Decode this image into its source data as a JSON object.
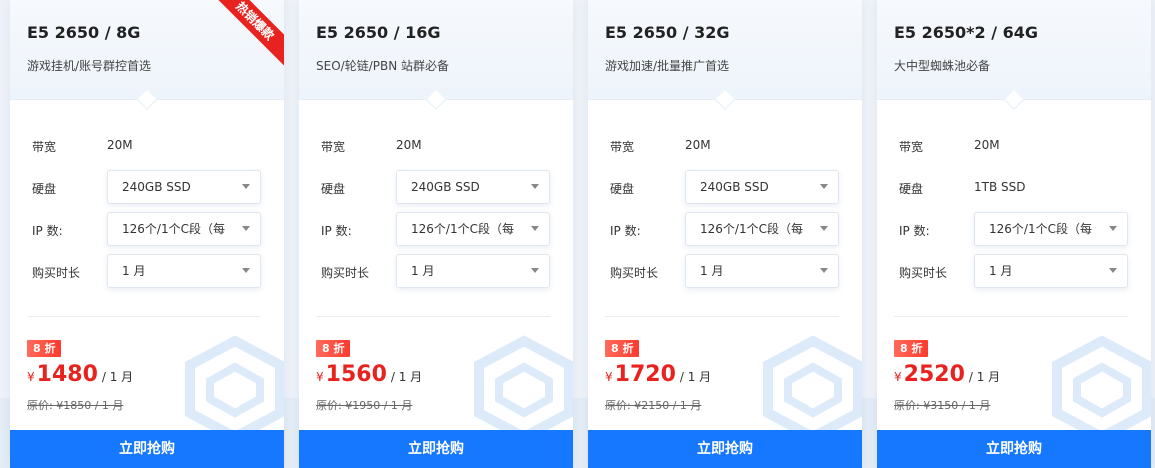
{
  "cards": [
    {
      "title": "E5 2650 / 8G",
      "subtitle": "游戏挂机/账号群控首选",
      "ribbon": "热销爆款",
      "bandwidth_label": "带宽",
      "bandwidth_value": "20M",
      "disk_label": "硬盘",
      "disk_value": "240GB SSD",
      "ip_label": "IP 数:",
      "ip_value": "126个/1个C段（每",
      "duration_label": "购买时长",
      "duration_value": "1 月",
      "discount": "8 折",
      "currency": "¥",
      "price": "1480",
      "per": "/ 1 月",
      "original": "原价: ¥1850 / 1 月",
      "buy_label": "立即抢购"
    },
    {
      "title": "E5 2650 / 16G",
      "subtitle": "SEO/轮链/PBN 站群必备",
      "ribbon": "",
      "bandwidth_label": "带宽",
      "bandwidth_value": "20M",
      "disk_label": "硬盘",
      "disk_value": "240GB SSD",
      "ip_label": "IP 数:",
      "ip_value": "126个/1个C段（每",
      "duration_label": "购买时长",
      "duration_value": "1 月",
      "discount": "8 折",
      "currency": "¥",
      "price": "1560",
      "per": "/ 1 月",
      "original": "原价: ¥1950 / 1 月",
      "buy_label": "立即抢购"
    },
    {
      "title": "E5 2650 / 32G",
      "subtitle": "游戏加速/批量推广首选",
      "ribbon": "",
      "bandwidth_label": "带宽",
      "bandwidth_value": "20M",
      "disk_label": "硬盘",
      "disk_value": "240GB SSD",
      "ip_label": "IP 数:",
      "ip_value": "126个/1个C段（每",
      "duration_label": "购买时长",
      "duration_value": "1 月",
      "discount": "8 折",
      "currency": "¥",
      "price": "1720",
      "per": "/ 1 月",
      "original": "原价: ¥2150 / 1 月",
      "buy_label": "立即抢购"
    },
    {
      "title": "E5 2650*2 / 64G",
      "subtitle": "大中型蜘蛛池必备",
      "ribbon": "",
      "bandwidth_label": "带宽",
      "bandwidth_value": "20M",
      "disk_label": "硬盘",
      "disk_value": "1TB SSD",
      "ip_label": "IP 数:",
      "ip_value": "126个/1个C段（每",
      "duration_label": "购买时长",
      "duration_value": "1 月",
      "discount": "8 折",
      "currency": "¥",
      "price": "2520",
      "per": "/ 1 月",
      "original": "原价: ¥3150 / 1 月",
      "buy_label": "立即抢购"
    }
  ],
  "colors": {
    "accent_blue": "#1677ff",
    "price_red": "#e8231f",
    "ribbon_red": "#e8231f"
  },
  "icons": {
    "select_caret": "chevron-down-icon",
    "card_decoration": "hexagon-decoration-icon"
  }
}
